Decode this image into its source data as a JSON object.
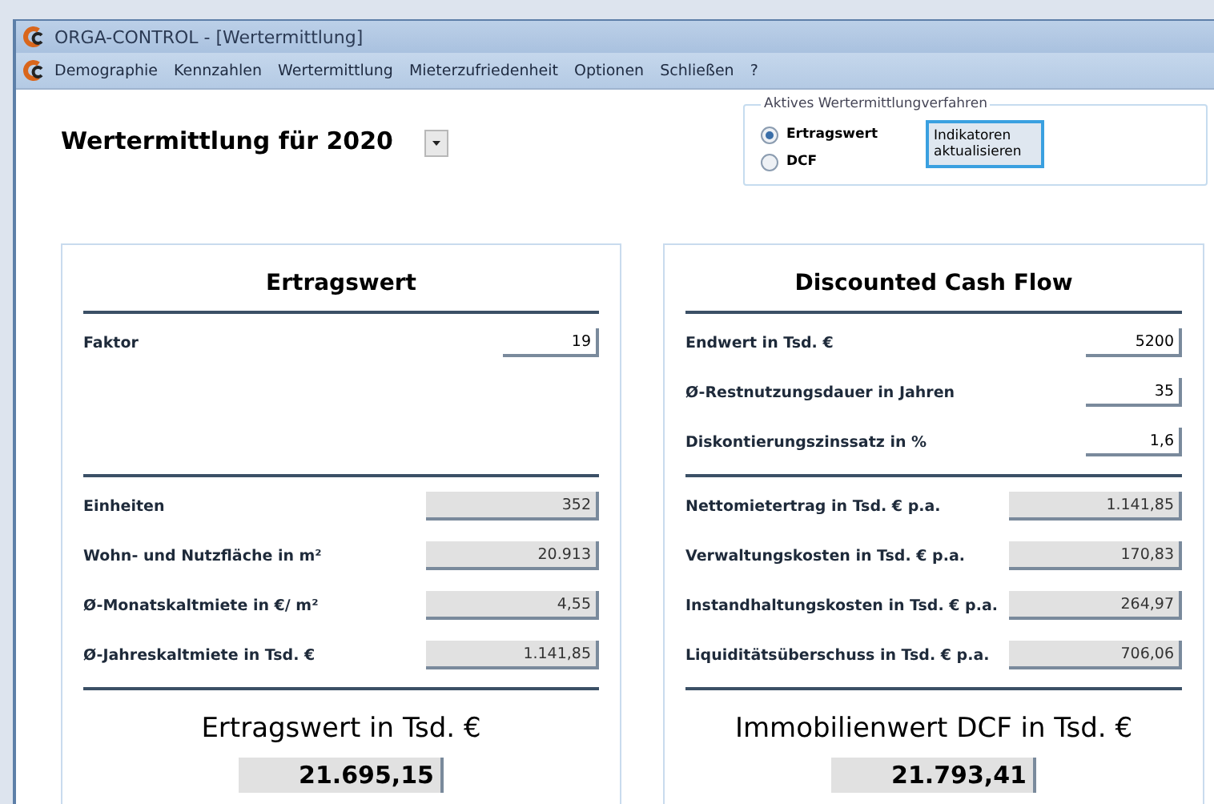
{
  "window": {
    "title": "ORGA-CONTROL - [Wertermittlung]"
  },
  "menu": [
    "Demographie",
    "Kennzahlen",
    "Wertermittlung",
    "Mieterzufriedenheit",
    "Optionen",
    "Schließen",
    "?"
  ],
  "heading": "Wertermittlung für 2020",
  "method_group": {
    "title": "Aktives Wertermittlungverfahren",
    "options": [
      {
        "label": "Ertragswert",
        "selected": true
      },
      {
        "label": "DCF",
        "selected": false
      }
    ],
    "button": "Indikatoren aktualisieren"
  },
  "panels": [
    {
      "title": "Ertragswert",
      "inputs": [
        {
          "label": "Faktor",
          "value": "19"
        }
      ],
      "outputs": [
        {
          "label": "Einheiten",
          "value": "352"
        },
        {
          "label": "Wohn- und Nutzfläche in m²",
          "value": "20.913"
        },
        {
          "label": "Ø-Monatskaltmiete in €/ m²",
          "value": "4,55"
        },
        {
          "label": "Ø-Jahreskaltmiete in Tsd. €",
          "value": "1.141,85"
        }
      ],
      "result_label": "Ertragswert in Tsd. €",
      "result_value": "21.695,15"
    },
    {
      "title": "Discounted Cash Flow",
      "inputs": [
        {
          "label": "Endwert in Tsd. €",
          "value": "5200"
        },
        {
          "label": "Ø-Restnutzungsdauer in Jahren",
          "value": "35"
        },
        {
          "label": "Diskontierungszinssatz in %",
          "value": "1,6"
        }
      ],
      "outputs": [
        {
          "label": "Nettomietertrag in Tsd. € p.a.",
          "value": "1.141,85"
        },
        {
          "label": "Verwaltungskosten in Tsd. € p.a.",
          "value": "170,83"
        },
        {
          "label": "Instandhaltungskosten in Tsd. € p.a.",
          "value": "264,97"
        },
        {
          "label": "Liquiditätsüberschuss in Tsd. € p.a.",
          "value": "706,06"
        }
      ],
      "result_label": "Immobilienwert DCF in Tsd. €",
      "result_value": "21.793,41"
    }
  ]
}
